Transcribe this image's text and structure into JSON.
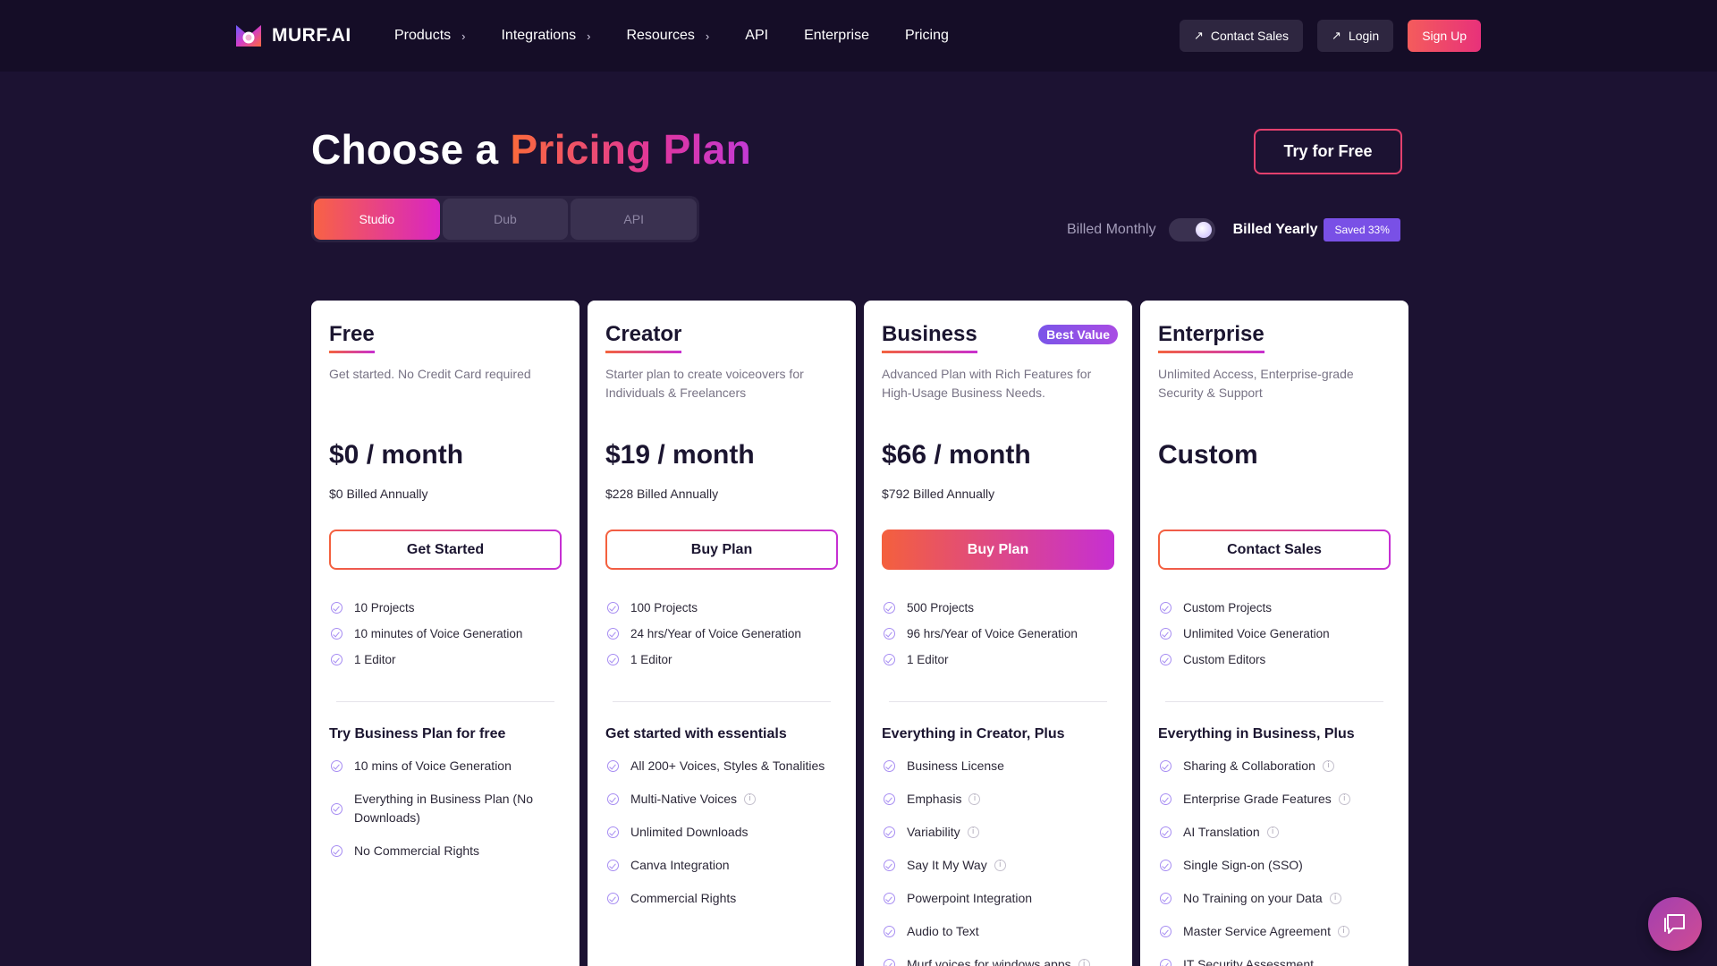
{
  "nav": {
    "logo_text": "MURF.AI",
    "links": [
      {
        "label": "Products",
        "has_chevron": true
      },
      {
        "label": "Integrations",
        "has_chevron": true
      },
      {
        "label": "Resources",
        "has_chevron": true
      },
      {
        "label": "API",
        "has_chevron": false
      },
      {
        "label": "Enterprise",
        "has_chevron": false
      },
      {
        "label": "Pricing",
        "has_chevron": false
      }
    ],
    "contact_sales": "Contact Sales",
    "login": "Login",
    "signup": "Sign Up"
  },
  "hero": {
    "title_plain": "Choose a ",
    "title_highlight": "Pricing Plan",
    "try_free": "Try for Free"
  },
  "tabs": [
    "Studio",
    "Dub",
    "API"
  ],
  "active_tab": "Studio",
  "billing": {
    "monthly_label": "Billed Monthly",
    "yearly_label": "Billed Yearly",
    "saved_badge": "Saved 33%",
    "yearly_selected": true
  },
  "plans": [
    {
      "name": "Free",
      "badge": "",
      "description": "Get started. No Credit Card required",
      "price": "$0 / month",
      "annual": "$0 Billed Annually",
      "cta": "Get Started",
      "cta_filled": false,
      "basics": [
        "10 Projects",
        "10 minutes of Voice Generation",
        "1 Editor"
      ],
      "section_title": "Try Business Plan for free",
      "features": [
        {
          "label": "10 mins of Voice Generation",
          "info": false
        },
        {
          "label": "Everything in Business Plan (No Downloads)",
          "info": false,
          "two_line": true
        },
        {
          "label": "No Commercial Rights",
          "info": false
        }
      ]
    },
    {
      "name": "Creator",
      "badge": "",
      "description": "Starter plan to create voiceovers for Individuals & Freelancers",
      "price": "$19 / month",
      "annual": "$228 Billed Annually",
      "cta": "Buy Plan",
      "cta_filled": false,
      "basics": [
        "100 Projects",
        "24 hrs/Year of Voice Generation",
        "1 Editor"
      ],
      "section_title": "Get started with essentials",
      "features": [
        {
          "label": "All 200+ Voices, Styles & Tonalities",
          "info": false
        },
        {
          "label": "Multi-Native Voices",
          "info": true
        },
        {
          "label": "Unlimited Downloads",
          "info": false
        },
        {
          "label": "Canva Integration",
          "info": false
        },
        {
          "label": "Commercial Rights",
          "info": false
        }
      ]
    },
    {
      "name": "Business",
      "badge": "Best Value",
      "description": "Advanced Plan with Rich Features for High-Usage Business Needs.",
      "price": "$66 / month",
      "annual": "$792 Billed Annually",
      "cta": "Buy Plan",
      "cta_filled": true,
      "basics": [
        "500 Projects",
        "96 hrs/Year of Voice Generation",
        "1 Editor"
      ],
      "section_title": "Everything in Creator, Plus",
      "features": [
        {
          "label": "Business License",
          "info": false
        },
        {
          "label": "Emphasis",
          "info": true
        },
        {
          "label": "Variability",
          "info": true
        },
        {
          "label": "Say It My Way",
          "info": true
        },
        {
          "label": "Powerpoint Integration",
          "info": false
        },
        {
          "label": "Audio to Text",
          "info": false
        },
        {
          "label": "Murf voices for windows apps",
          "info": true
        }
      ]
    },
    {
      "name": "Enterprise",
      "badge": "",
      "description": "Unlimited Access, Enterprise-grade Security & Support",
      "price": "Custom",
      "annual": "",
      "cta": "Contact Sales",
      "cta_filled": false,
      "basics": [
        "Custom Projects",
        "Unlimited Voice Generation",
        "Custom Editors"
      ],
      "section_title": "Everything in Business, Plus",
      "features": [
        {
          "label": "Sharing & Collaboration",
          "info": true
        },
        {
          "label": "Enterprise Grade Features",
          "info": true
        },
        {
          "label": "AI Translation",
          "info": true
        },
        {
          "label": "Single Sign-on (SSO)",
          "info": false
        },
        {
          "label": "No Training on your Data",
          "info": true
        },
        {
          "label": "Master Service Agreement",
          "info": true
        },
        {
          "label": "IT Security Assessment",
          "info": false
        }
      ]
    }
  ],
  "icons": {
    "check": "check-circle-icon",
    "info": "info-icon",
    "chat": "chat-icon",
    "arrow": "arrow-up-right-icon",
    "chevron": "chevron-right-icon"
  },
  "colors": {
    "background": "#1c1232",
    "nav_background": "#150d27",
    "accent_start": "#f4603d",
    "accent_end": "#c62fd3",
    "badge_purple": "#7950e6"
  }
}
